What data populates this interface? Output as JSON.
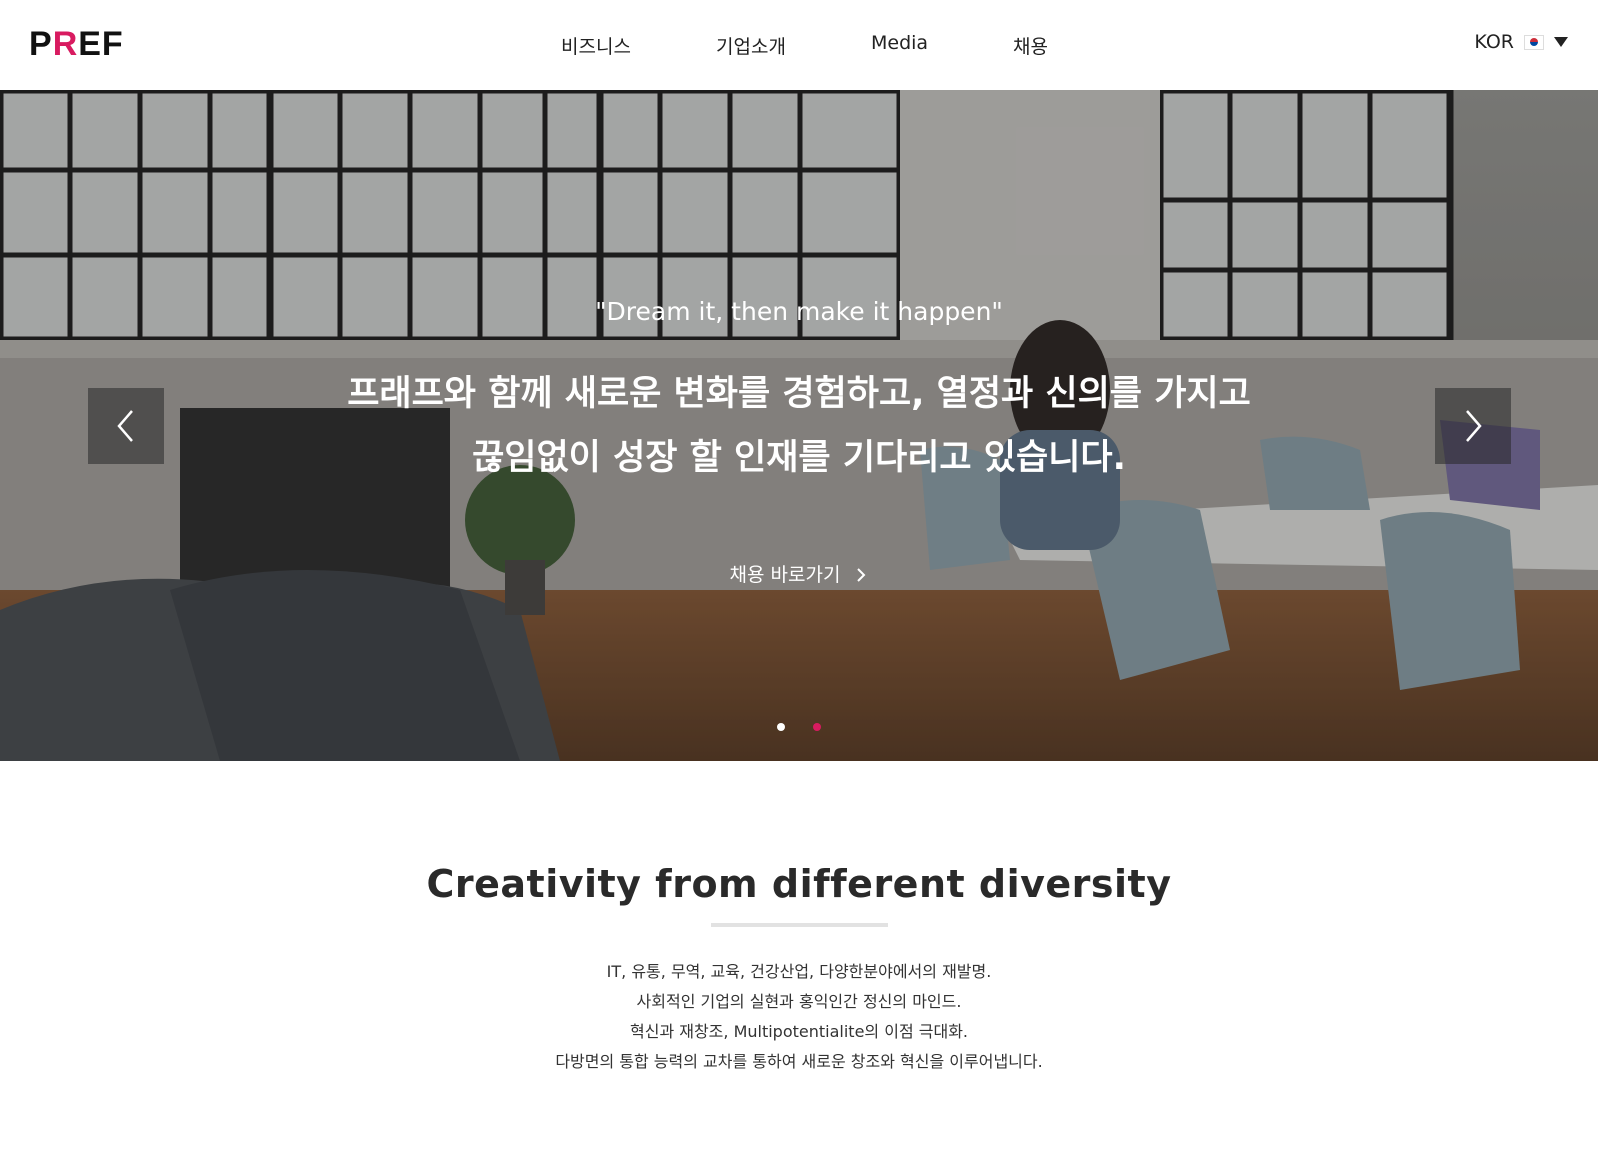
{
  "header": {
    "logo": {
      "text_pre": "P",
      "accent": "R",
      "text_post": "EF",
      "accent_color": "#d81b60"
    },
    "nav": [
      "비즈니스",
      "기업소개",
      "Media",
      "채용"
    ],
    "language": {
      "label": "KOR",
      "flag_icon": "korea-flag-icon"
    }
  },
  "hero": {
    "quote": "\"Dream it, then make it happen\"",
    "headline_line1": "프래프와 함께 새로운 변화를 경험하고, 열정과 신의를 가지고",
    "headline_line2": "끊임없이 성장 할 인재를 기다리고 있습니다.",
    "cta_label": "채용 바로가기",
    "slides": {
      "count": 2,
      "active_index": 1
    }
  },
  "intro": {
    "title": "Creativity from different diversity",
    "lines": [
      "IT, 유통, 무역, 교육, 건강산업, 다양한분야에서의 재발명.",
      "사회적인 기업의 실현과 홍익인간 정신의 마인드.",
      "혁신과 재창조, Multipotentialite의 이점 극대화.",
      "다방면의 통합 능력의 교차를 통하여 새로운 창조와 혁신을 이루어냅니다."
    ]
  },
  "colors": {
    "accent": "#d81b60",
    "text": "#222222"
  }
}
